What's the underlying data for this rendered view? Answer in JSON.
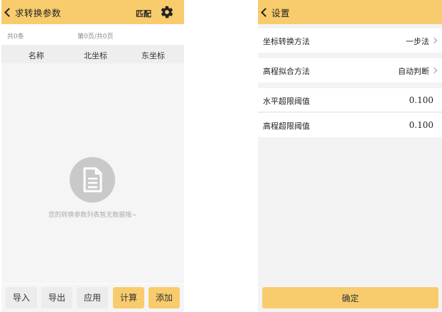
{
  "left_screen": {
    "header": {
      "title": "求转换参数",
      "match_label": "匹配",
      "settings_icon": "gear-icon"
    },
    "meta": {
      "count": "共0条",
      "pagination": "第0页/共0页"
    },
    "table": {
      "columns": [
        "名称",
        "北坐标",
        "东坐标"
      ]
    },
    "empty_state": {
      "icon": "document-icon",
      "message": "您的转换参数列表暂无数据哦~"
    },
    "footer_buttons": [
      "导入",
      "导出",
      "应用",
      "计算",
      "添加"
    ]
  },
  "right_screen": {
    "header": {
      "title": "设置"
    },
    "rows": [
      {
        "label": "坐标转换方法",
        "value": "一步法"
      },
      {
        "label": "高程拟合方法",
        "value": "自动判断"
      },
      {
        "label": "水平超限阈值",
        "value": "0.100"
      },
      {
        "label": "高程超限阈值",
        "value": "0.100"
      }
    ],
    "confirm_label": "确定"
  },
  "colors": {
    "accent": "#f8cc6c",
    "background": "#f3f3f3"
  }
}
